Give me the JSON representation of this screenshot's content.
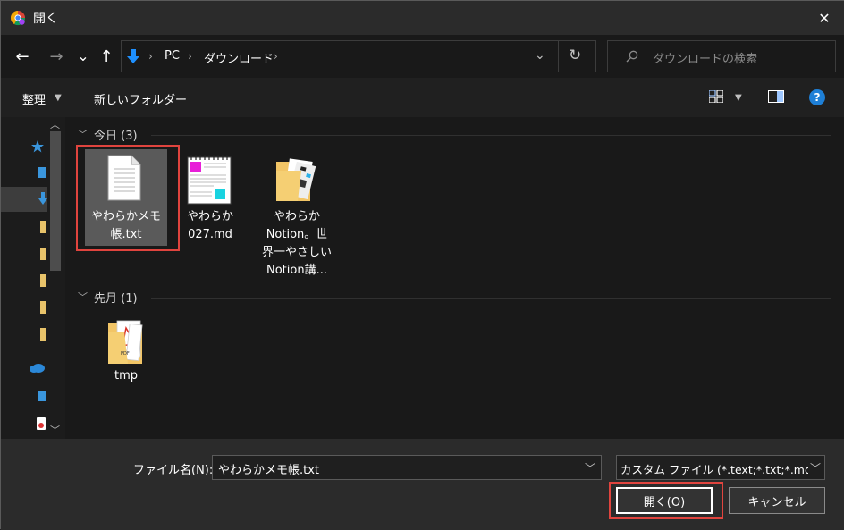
{
  "window": {
    "title": "開く",
    "close_glyph": "✕"
  },
  "nav": {
    "back_icon": "←",
    "forward_icon": "→",
    "recent_icon": "⌄",
    "up_icon": "↑"
  },
  "address": {
    "segments": [
      "PC",
      "ダウンロード"
    ],
    "separator": "›",
    "refresh_icon": "↻"
  },
  "search": {
    "placeholder": "ダウンロードの検索"
  },
  "toolbar": {
    "organize_label": "整理",
    "new_folder_label": "新しいフォルダー",
    "help_label": "?"
  },
  "groups": [
    {
      "header": "今日 (3)",
      "files": [
        {
          "line1": "やわらかメモ",
          "line2": "帳.txt",
          "line3": "",
          "line4": "",
          "icon": "text-file-icon"
        },
        {
          "line1": "やわらか",
          "line2": "027.md",
          "line3": "",
          "line4": "",
          "icon": "notebook-file-icon"
        },
        {
          "line1": "やわらか",
          "line2": "Notion。世",
          "line3": "界一やさしい",
          "line4": "Notion講...",
          "icon": "folder-icon"
        }
      ]
    },
    {
      "header": "先月 (1)",
      "files": [
        {
          "line1": "tmp",
          "line2": "",
          "line3": "",
          "line4": "",
          "icon": "pdf-folder-icon"
        }
      ]
    }
  ],
  "footer": {
    "filename_label": "ファイル名(N):",
    "filename_value": "やわらかメモ帳.txt",
    "filter_value": "カスタム ファイル (*.text;*.txt;*.md;*",
    "open_label": "開く(O)",
    "cancel_label": "キャンセル"
  },
  "colors": {
    "accent_blue": "#1e90ff",
    "highlight_red": "#e0443e",
    "selection": "#5a5a5a"
  }
}
